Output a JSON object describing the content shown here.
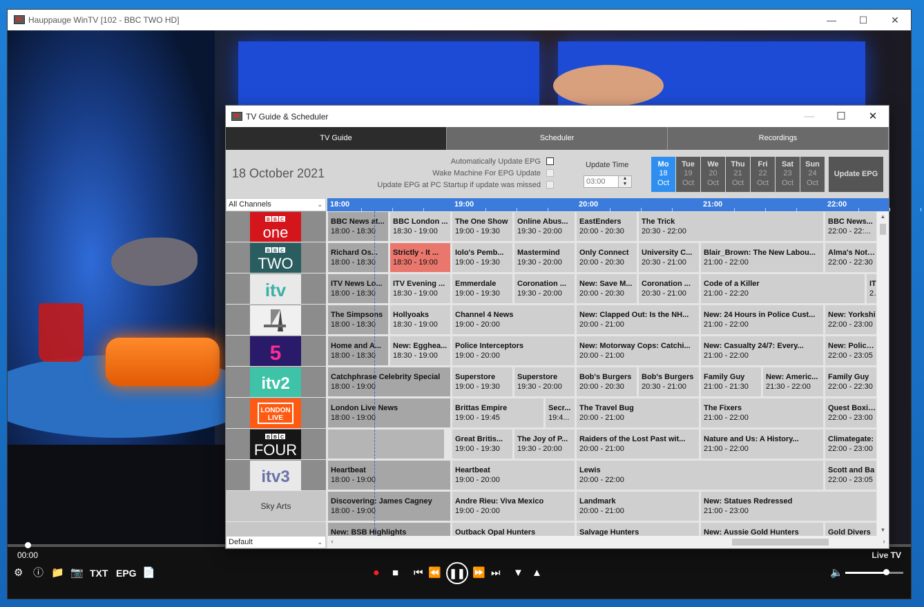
{
  "window": {
    "title": "Hauppauge WinTV [102 - BBC TWO HD]"
  },
  "player": {
    "position": "00:00",
    "status": "Live TV",
    "buttons": {
      "txt": "TXT",
      "epg": "EPG"
    },
    "volume_percent": 70,
    "seek_percent": 2
  },
  "guide": {
    "title": "TV Guide & Scheduler",
    "tabs": [
      "TV Guide",
      "Scheduler",
      "Recordings"
    ],
    "active_tab": "TV Guide",
    "date": "18 October 2021",
    "options": [
      {
        "label": "Automatically Update EPG",
        "checked": false,
        "enabled": true
      },
      {
        "label": "Wake Machine For EPG Update",
        "checked": false,
        "enabled": false
      },
      {
        "label": "Update EPG at PC Startup if update was missed",
        "checked": false,
        "enabled": false
      }
    ],
    "update_time_label": "Update Time",
    "update_time": "03:00",
    "days": [
      {
        "name": "Mo",
        "num": "18",
        "mon": "Oct",
        "active": true
      },
      {
        "name": "Tue",
        "num": "19",
        "mon": "Oct"
      },
      {
        "name": "We",
        "num": "20",
        "mon": "Oct"
      },
      {
        "name": "Thu",
        "num": "21",
        "mon": "Oct"
      },
      {
        "name": "Fri",
        "num": "22",
        "mon": "Oct"
      },
      {
        "name": "Sat",
        "num": "23",
        "mon": "Oct"
      },
      {
        "name": "Sun",
        "num": "24",
        "mon": "Oct"
      }
    ],
    "update_epg_label": "Update EPG",
    "channel_filter": "All Channels",
    "profile": "Default",
    "timeline": [
      "18:00",
      "19:00",
      "20:00",
      "21:00",
      "22:00"
    ],
    "colors": {
      "timeline": "#3a7bdc",
      "active_day": "#2f8ff0",
      "on_now": "#e9776d"
    },
    "channels": [
      {
        "name": "BBC One",
        "logo": "bbc-one-logo",
        "programmes": [
          {
            "title": "BBC News at...",
            "time": "18:00 - 18:30",
            "state": "past"
          },
          {
            "title": "BBC London ...",
            "time": "18:30 - 19:00"
          },
          {
            "title": "The One Show",
            "time": "19:00 - 19:30"
          },
          {
            "title": "Online Abus...",
            "time": "19:30 - 20:00"
          },
          {
            "title": "EastEnders",
            "time": "20:00 - 20:30"
          },
          {
            "title": "The Trick",
            "time": "20:30 - 22:00"
          },
          {
            "title": "BBC News...",
            "time": "22:00 - 22:..."
          }
        ]
      },
      {
        "name": "BBC Two",
        "logo": "bbc-two-logo",
        "programmes": [
          {
            "title": "Richard Os...",
            "time": "18:00 - 18:30",
            "state": "past"
          },
          {
            "title": "Strictly - It ...",
            "time": "18:30 - 19:00",
            "state": "current"
          },
          {
            "title": "Iolo's Pemb...",
            "time": "19:00 - 19:30"
          },
          {
            "title": "Mastermind",
            "time": "19:30 - 20:00"
          },
          {
            "title": "Only Connect",
            "time": "20:00 - 20:30"
          },
          {
            "title": "University C...",
            "time": "20:30 - 21:00"
          },
          {
            "title": "Blair_Brown: The New Labou...",
            "time": "21:00 - 22:00"
          },
          {
            "title": "Alma's Not N...",
            "time": "22:00 - 22:30"
          }
        ]
      },
      {
        "name": "ITV",
        "logo": "itv-logo",
        "programmes": [
          {
            "title": "ITV News Lo...",
            "time": "18:00 - 18:30",
            "state": "past"
          },
          {
            "title": "ITV Evening ...",
            "time": "18:30 - 19:00"
          },
          {
            "title": "Emmerdale",
            "time": "19:00 - 19:30"
          },
          {
            "title": "Coronation ...",
            "time": "19:30 - 20:00"
          },
          {
            "title": "New: Save M...",
            "time": "20:00 - 20:30"
          },
          {
            "title": "Coronation ...",
            "time": "20:30 - 21:00"
          },
          {
            "title": "Code of a Killer",
            "time": "21:00 - 22:20"
          },
          {
            "title": "IT",
            "time": "22"
          }
        ]
      },
      {
        "name": "Channel 4",
        "logo": "channel-4-logo",
        "programmes": [
          {
            "title": "The Simpsons",
            "time": "18:00 - 18:30",
            "state": "past"
          },
          {
            "title": "Hollyoaks",
            "time": "18:30 - 19:00"
          },
          {
            "title": "Channel 4 News",
            "time": "19:00 - 20:00"
          },
          {
            "title": "New: Clapped Out: Is the NH...",
            "time": "20:00 - 21:00"
          },
          {
            "title": "New: 24 Hours in Police Cust...",
            "time": "21:00 - 22:00"
          },
          {
            "title": "New: Yorkshi",
            "time": "22:00 - 23:00"
          }
        ]
      },
      {
        "name": "Channel 5",
        "logo": "channel-5-logo",
        "programmes": [
          {
            "title": "Home and A...",
            "time": "18:00 - 18:30",
            "state": "past"
          },
          {
            "title": "New: Egghea...",
            "time": "18:30 - 19:00"
          },
          {
            "title": "Police Interceptors",
            "time": "19:00 - 20:00"
          },
          {
            "title": "New: Motorway Cops: Catchi...",
            "time": "20:00 - 21:00"
          },
          {
            "title": "New: Casualty 24/7: Every...",
            "time": "21:00 - 22:00"
          },
          {
            "title": "New: Police C",
            "time": "22:00 - 23:05"
          }
        ]
      },
      {
        "name": "ITV2",
        "logo": "itv2-logo",
        "programmes": [
          {
            "title": "Catchphrase Celebrity Special",
            "time": "18:00 - 19:00",
            "state": "past"
          },
          {
            "title": "Superstore",
            "time": "19:00 - 19:30"
          },
          {
            "title": "Superstore",
            "time": "19:30 - 20:00"
          },
          {
            "title": "Bob's Burgers",
            "time": "20:00 - 20:30"
          },
          {
            "title": "Bob's Burgers",
            "time": "20:30 - 21:00"
          },
          {
            "title": "Family Guy",
            "time": "21:00 - 21:30"
          },
          {
            "title": "New: Americ...",
            "time": "21:30 - 22:00"
          },
          {
            "title": "Family Guy",
            "time": "22:00 - 22:30"
          }
        ]
      },
      {
        "name": "London Live",
        "logo": "london-live-logo",
        "logo_text": "LONDON LIVE",
        "programmes": [
          {
            "title": "London Live News",
            "time": "18:00 - 19:00",
            "state": "past"
          },
          {
            "title": "Brittas Empire",
            "time": "19:00 - 19:45"
          },
          {
            "title": "Secr...",
            "time": "19:4..."
          },
          {
            "title": "The Travel Bug",
            "time": "20:00 - 21:00"
          },
          {
            "title": "The Fixers",
            "time": "21:00 - 22:00"
          },
          {
            "title": "Quest Boxing",
            "time": "22:00 - 23:00"
          }
        ]
      },
      {
        "name": "BBC Four",
        "logo": "bbc-four-logo",
        "programmes": [
          {
            "title": "",
            "time": "",
            "state": "empty"
          },
          {
            "title": "Great Britis...",
            "time": "19:00 - 19:30"
          },
          {
            "title": "The Joy of P...",
            "time": "19:30 - 20:00"
          },
          {
            "title": "Raiders of the Lost Past wit...",
            "time": "20:00 - 21:00"
          },
          {
            "title": "Nature and Us: A History...",
            "time": "21:00 - 22:00"
          },
          {
            "title": "Climategate:",
            "time": "22:00 - 23:00"
          }
        ]
      },
      {
        "name": "ITV3",
        "logo": "itv3-logo",
        "programmes": [
          {
            "title": "Heartbeat",
            "time": "18:00 - 19:00",
            "state": "past"
          },
          {
            "title": "Heartbeat",
            "time": "19:00 - 20:00"
          },
          {
            "title": "Lewis",
            "time": "20:00 - 22:00"
          },
          {
            "title": "Scott and Ba",
            "time": "22:00 - 23:05"
          }
        ]
      },
      {
        "name": "Sky Arts",
        "logo_text": "Sky Arts",
        "programmes": [
          {
            "title": "Discovering: James Cagney",
            "time": "18:00 - 19:00",
            "state": "past"
          },
          {
            "title": "Andre Rieu: Viva Mexico",
            "time": "19:00 - 20:00"
          },
          {
            "title": "Landmark",
            "time": "20:00 - 21:00"
          },
          {
            "title": "New: Statues Redressed",
            "time": "21:00 - 23:00"
          }
        ]
      },
      {
        "name": "",
        "programmes": [
          {
            "title": "New: BSB Highlights",
            "time": "",
            "state": "past"
          },
          {
            "title": "Outback Opal Hunters",
            "time": ""
          },
          {
            "title": "Salvage Hunters",
            "time": ""
          },
          {
            "title": "New: Aussie Gold Hunters",
            "time": ""
          },
          {
            "title": "Gold Divers",
            "time": ""
          }
        ]
      }
    ]
  }
}
